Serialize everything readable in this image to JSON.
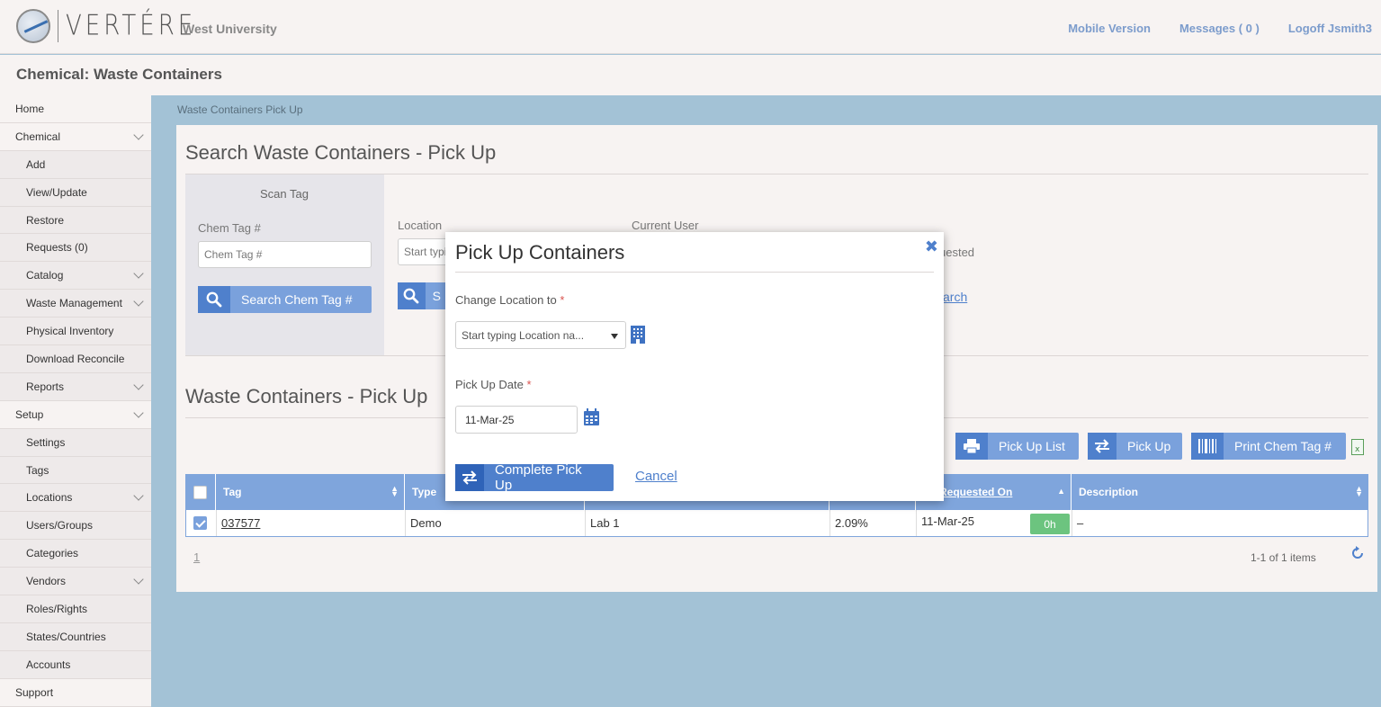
{
  "header": {
    "logo_text": "VERTÉRE",
    "org_name": "West University",
    "links": [
      "Mobile Version",
      "Messages ( 0 )",
      "Logoff Jsmith3"
    ]
  },
  "page_title": "Chemical: Waste Containers",
  "sidebar": [
    {
      "label": "Home",
      "level": "top"
    },
    {
      "label": "Chemical",
      "level": "top",
      "expandable": true
    },
    {
      "label": "Add",
      "level": "sub"
    },
    {
      "label": "View/Update",
      "level": "sub"
    },
    {
      "label": "Restore",
      "level": "sub"
    },
    {
      "label": "Requests (0)",
      "level": "sub"
    },
    {
      "label": "Catalog",
      "level": "sub",
      "expandable": true
    },
    {
      "label": "Waste Management",
      "level": "sub",
      "expandable": true
    },
    {
      "label": "Physical Inventory",
      "level": "sub"
    },
    {
      "label": "Download Reconcile",
      "level": "sub"
    },
    {
      "label": "Reports",
      "level": "sub",
      "expandable": true
    },
    {
      "label": "Setup",
      "level": "top",
      "expandable": true
    },
    {
      "label": "Settings",
      "level": "sub"
    },
    {
      "label": "Tags",
      "level": "sub"
    },
    {
      "label": "Locations",
      "level": "sub",
      "expandable": true
    },
    {
      "label": "Users/Groups",
      "level": "sub"
    },
    {
      "label": "Categories",
      "level": "sub"
    },
    {
      "label": "Vendors",
      "level": "sub",
      "expandable": true
    },
    {
      "label": "Roles/Rights",
      "level": "sub"
    },
    {
      "label": "States/Countries",
      "level": "sub"
    },
    {
      "label": "Accounts",
      "level": "sub"
    },
    {
      "label": "Support",
      "level": "top"
    }
  ],
  "breadcrumb": "Waste Containers Pick Up",
  "search": {
    "title": "Search Waste Containers - Pick Up",
    "scan_tag_label": "Scan Tag",
    "chem_tag_label": "Chem Tag #",
    "chem_tag_placeholder": "Chem Tag #",
    "search_chem_tag_button": "Search Chem Tag #",
    "location_label": "Location",
    "location_placeholder": "Start typi",
    "search_button_partial": "S",
    "current_user_label": "Current User",
    "requested_partial": "uested",
    "search_link_partial": "arch"
  },
  "results": {
    "title": "Waste Containers - Pick Up",
    "buttons": {
      "pickup_list": "Pick Up List",
      "pickup": "Pick Up",
      "print_tag": "Print Chem Tag #"
    },
    "columns": {
      "tag": "Tag",
      "type": "Type",
      "requested_on": "up Requested On",
      "description": "Description"
    },
    "rows": [
      {
        "tag": "037577",
        "type": "Demo",
        "location": "Lab 1",
        "percent": "2.09%",
        "requested_on": "11-Mar-25",
        "age": "0h",
        "description": "–"
      }
    ],
    "pager_page": "1",
    "pager_summary": "1-1 of 1 items"
  },
  "modal": {
    "title": "Pick Up Containers",
    "change_location_label": "Change Location to",
    "required_mark": "*",
    "location_placeholder": "Start typing Location na...",
    "pickup_date_label": "Pick Up Date",
    "pickup_date_value": "11-Mar-25",
    "complete_button": "Complete Pick Up",
    "cancel_link": "Cancel"
  },
  "colors": {
    "accent": "#4f80cc",
    "button_light": "#7aa1dc",
    "badge": "#6cc47f",
    "background": "#a3c2d6"
  }
}
